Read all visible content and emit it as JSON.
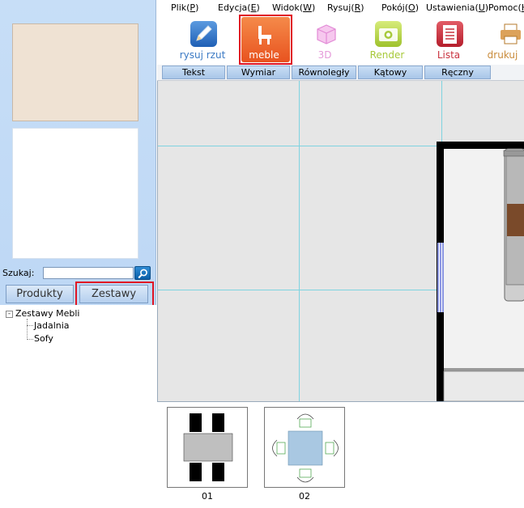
{
  "menu": {
    "items": [
      {
        "label": "Plik",
        "key": "P"
      },
      {
        "label": "Edycja",
        "key": "E"
      },
      {
        "label": "Widok",
        "key": "W"
      },
      {
        "label": "Rysuj",
        "key": "R"
      },
      {
        "label": "Pokój",
        "key": "O"
      },
      {
        "label": "Ustawienia",
        "key": "U"
      },
      {
        "label": "Pomoc",
        "key": "H"
      }
    ]
  },
  "toolbar": {
    "tools": [
      {
        "label": "rysuj rzut",
        "icon": "pencil-icon",
        "color": "#3a79c4"
      },
      {
        "label": "meble",
        "icon": "chair-icon",
        "color": "#ffffff"
      },
      {
        "label": "3D",
        "icon": "cube-icon",
        "color": "#e59ad9"
      },
      {
        "label": "Render",
        "icon": "camera-icon",
        "color": "#a7c93a"
      },
      {
        "label": "Lista",
        "icon": "list-icon",
        "color": "#c9333f"
      },
      {
        "label": "drukuj",
        "icon": "printer-icon",
        "color": "#c98b3a"
      }
    ]
  },
  "subtoolbar": {
    "tabs": [
      "Tekst",
      "Wymiar Liniowy",
      "Równoległy",
      "Kątowy",
      "Ręczny"
    ]
  },
  "left": {
    "search_label": "Szukaj:",
    "search_value": "",
    "produkty_label": "Produkty",
    "zestawy_label": "Zestawy",
    "tree": {
      "root": "Zestawy Mebli",
      "expander": "-",
      "children": [
        "Jadalnia",
        "Sofy"
      ]
    }
  },
  "thumbnails": [
    {
      "label": "01"
    },
    {
      "label": "02"
    }
  ],
  "colors": {
    "highlight": "#e01524",
    "panel": "#c2daf6",
    "canvas": "#e6e6e6",
    "grid": "#7fd3e0"
  }
}
